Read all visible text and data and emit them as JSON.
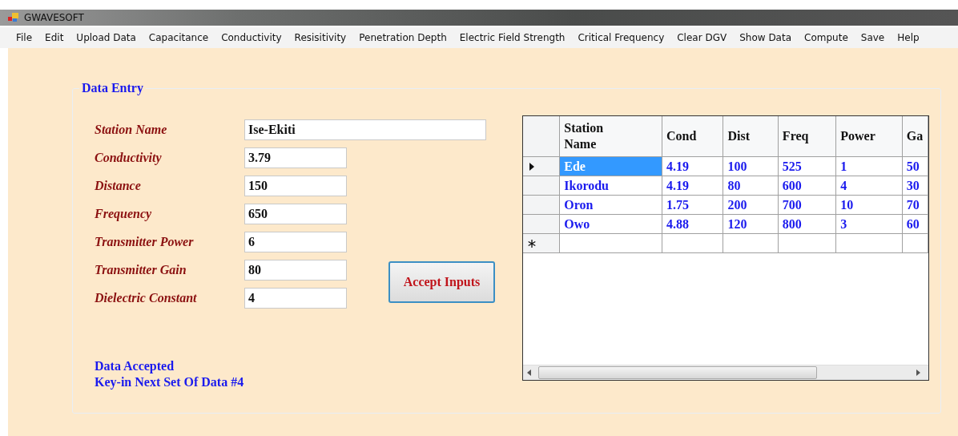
{
  "window": {
    "title": "GWAVESOFT"
  },
  "menu": [
    "File",
    "Edit",
    "Upload Data",
    "Capacitance",
    "Conductivity",
    "Resisitivity",
    "Penetration Depth",
    "Electric Field Strength",
    "Critical Frequency",
    "Clear DGV",
    "Show Data",
    "Compute",
    "Save",
    "Help"
  ],
  "data_entry": {
    "title": "Data Entry",
    "fields": [
      {
        "label": "Station Name",
        "value": "Ise-Ekiti",
        "kind": "wide"
      },
      {
        "label": "Conductivity",
        "value": "3.79",
        "kind": "short"
      },
      {
        "label": "Distance",
        "value": "150",
        "kind": "short"
      },
      {
        "label": "Frequency",
        "value": "650",
        "kind": "short"
      },
      {
        "label": "Transmitter Power",
        "value": "6",
        "kind": "short"
      },
      {
        "label": "Transmitter Gain",
        "value": "80",
        "kind": "short"
      },
      {
        "label": "Dielectric Constant",
        "value": "4",
        "kind": "short"
      }
    ],
    "button": "Accept Inputs",
    "messages": [
      "Data Accepted",
      "Key-in Next Set Of Data #4"
    ]
  },
  "table": {
    "columns": [
      "Station\nName",
      "Cond",
      "Dist",
      "Freq",
      "Power",
      "Ga"
    ],
    "rows": [
      {
        "selected": true,
        "cells": [
          "Ede",
          "4.19",
          "100",
          "525",
          "1",
          "50"
        ]
      },
      {
        "selected": false,
        "cells": [
          "Ikorodu",
          "4.19",
          "80",
          "600",
          "4",
          "30"
        ]
      },
      {
        "selected": false,
        "cells": [
          "Oron",
          "1.75",
          "200",
          "700",
          "10",
          "70"
        ]
      },
      {
        "selected": false,
        "cells": [
          "Owo",
          "4.88",
          "120",
          "800",
          "3",
          "60"
        ]
      }
    ]
  }
}
